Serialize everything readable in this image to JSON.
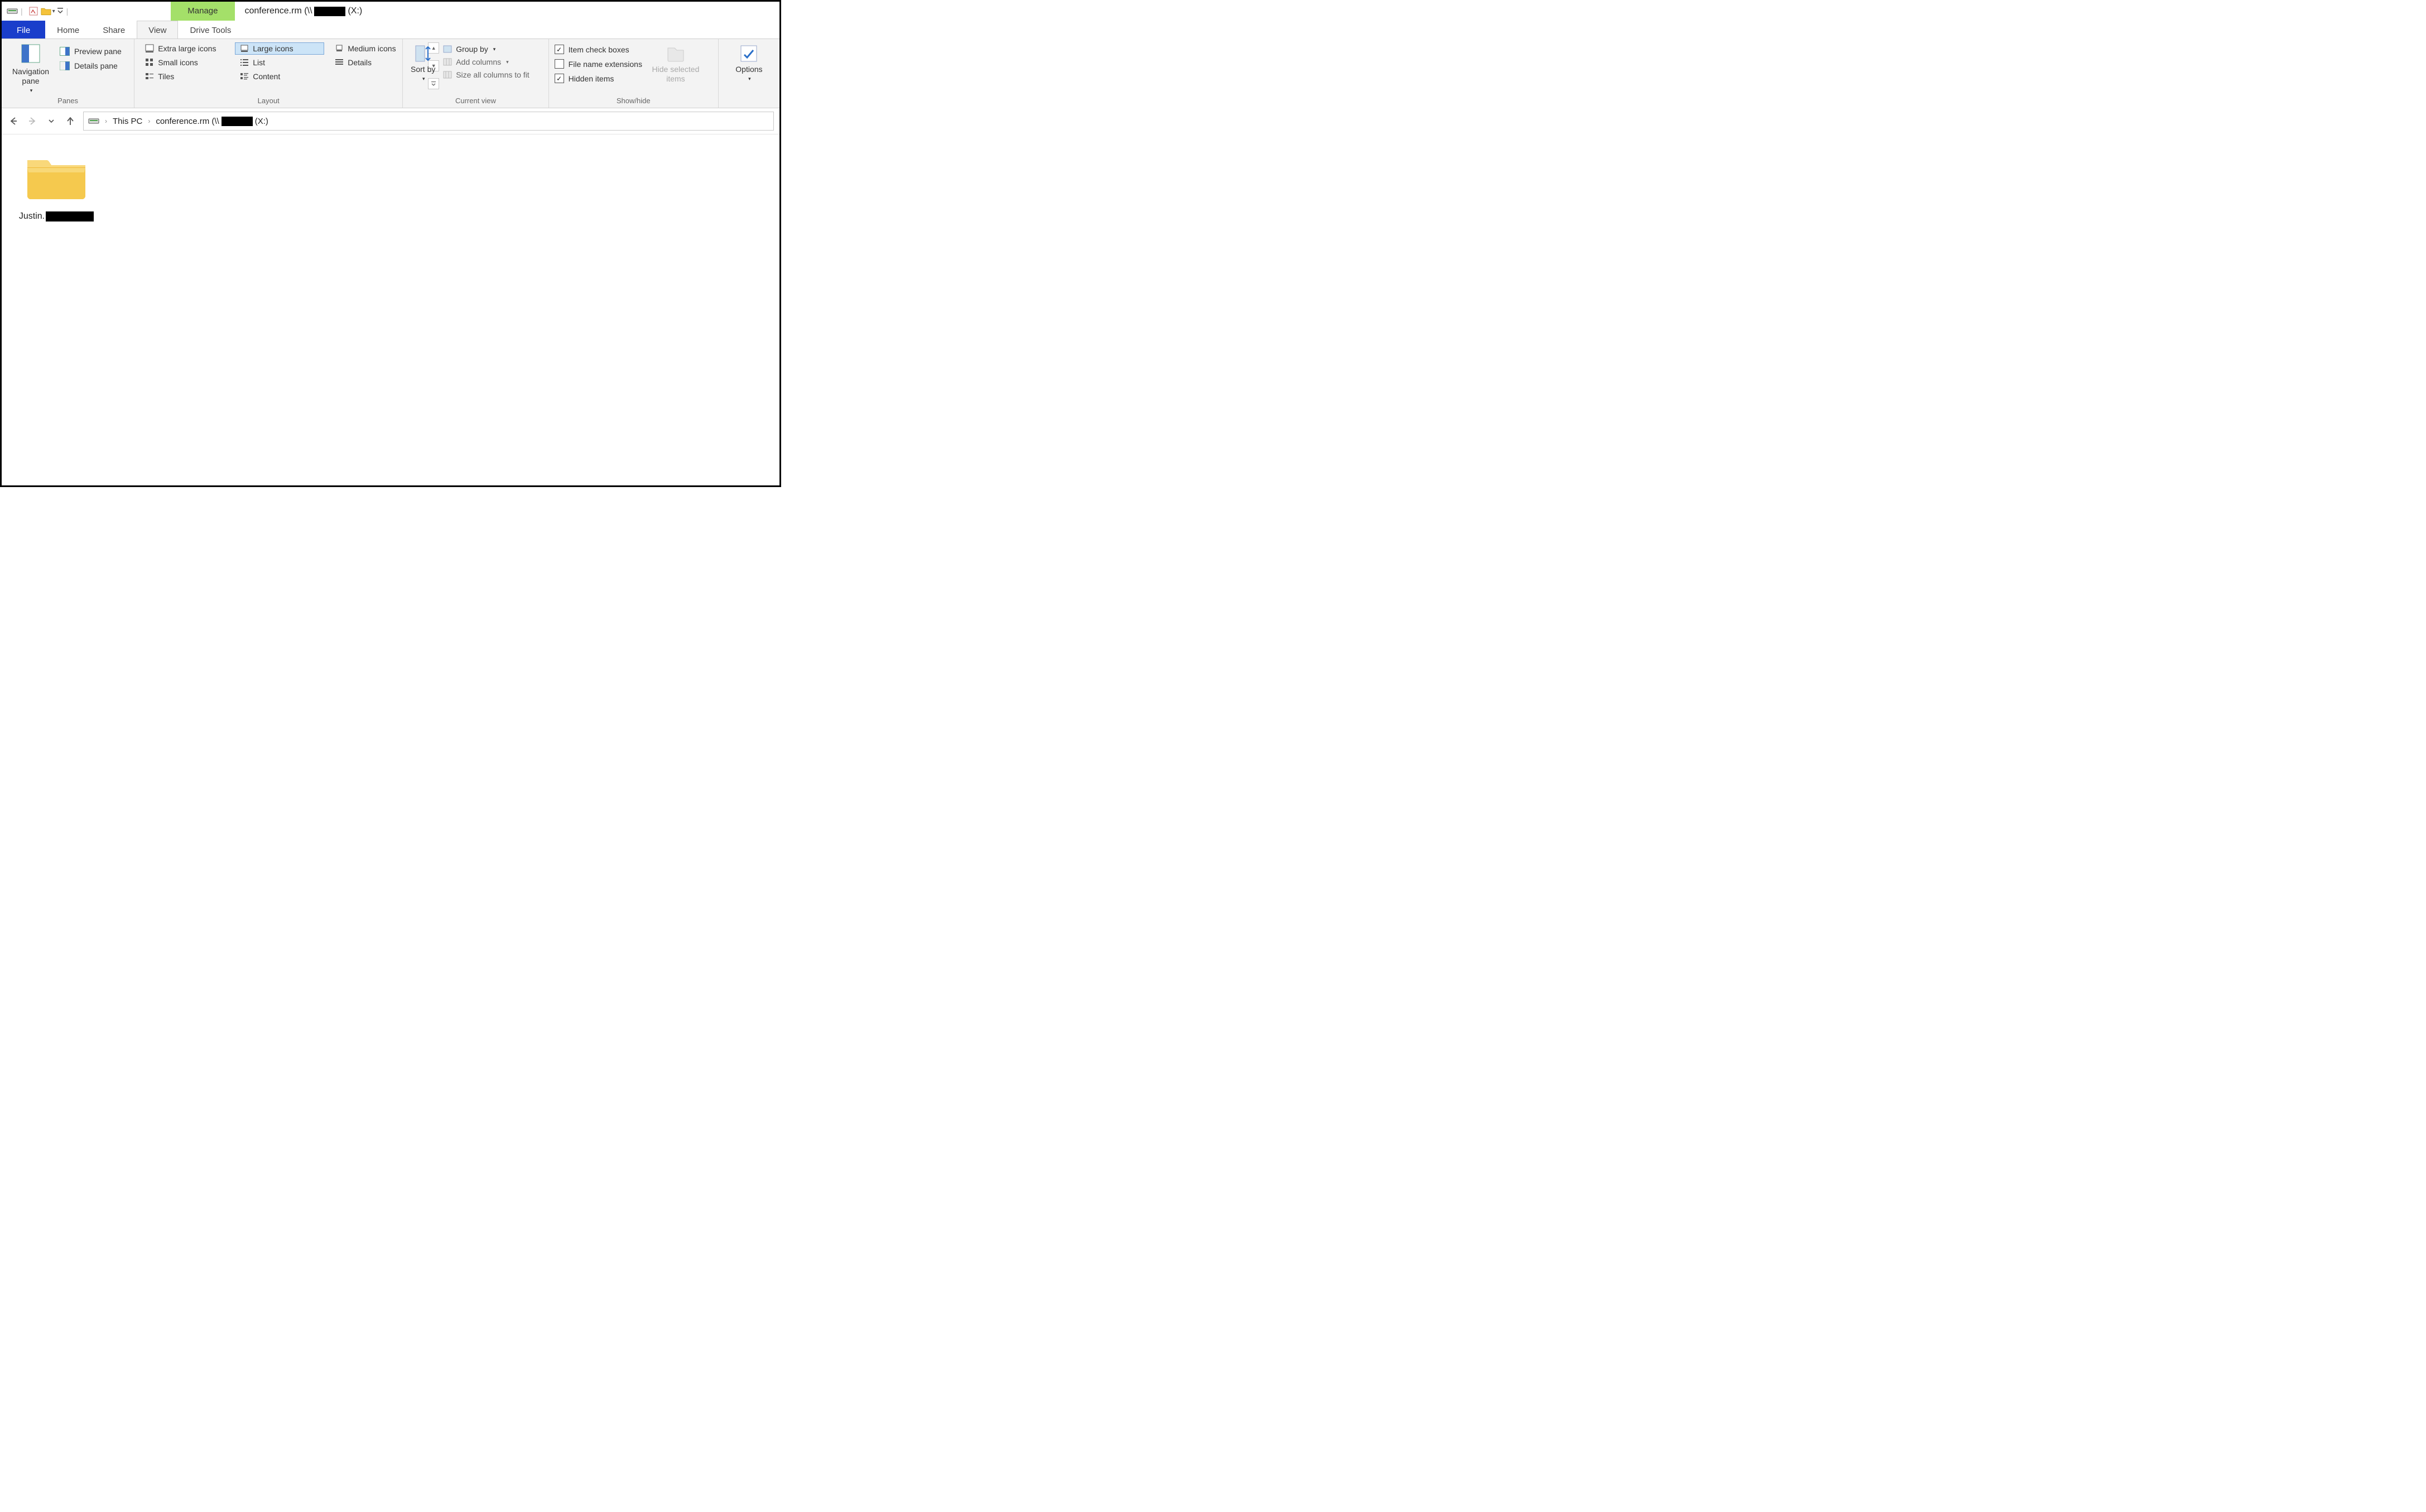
{
  "title": {
    "context_tab": "Manage",
    "prefix": "conference.rm (\\\\",
    "suffix": " (X:)"
  },
  "qat": {
    "customize_tip": "Customize Quick Access Toolbar"
  },
  "tabs": {
    "file": "File",
    "home": "Home",
    "share": "Share",
    "view": "View",
    "drive": "Drive Tools"
  },
  "ribbon": {
    "panes": {
      "label": "Panes",
      "navigation": "Navigation pane",
      "preview": "Preview pane",
      "details": "Details pane"
    },
    "layout": {
      "label": "Layout",
      "xl": "Extra large icons",
      "large": "Large icons",
      "medium": "Medium icons",
      "small": "Small icons",
      "list": "List",
      "details": "Details",
      "tiles": "Tiles",
      "content": "Content"
    },
    "currentview": {
      "label": "Current view",
      "sortby": "Sort by",
      "groupby": "Group by",
      "addcolumns": "Add columns",
      "sizeall": "Size all columns to fit"
    },
    "showhide": {
      "label": "Show/hide",
      "itemcheck": "Item check boxes",
      "extensions": "File name extensions",
      "hidden": "Hidden items",
      "hideselected_l1": "Hide selected",
      "hideselected_l2": "items"
    },
    "options": {
      "label": "Options"
    }
  },
  "breadcrumb": {
    "thispc": "This PC",
    "drive_prefix": "conference.rm (\\\\",
    "drive_suffix": " (X:)"
  },
  "content": {
    "folder_name_prefix": "Justin."
  }
}
